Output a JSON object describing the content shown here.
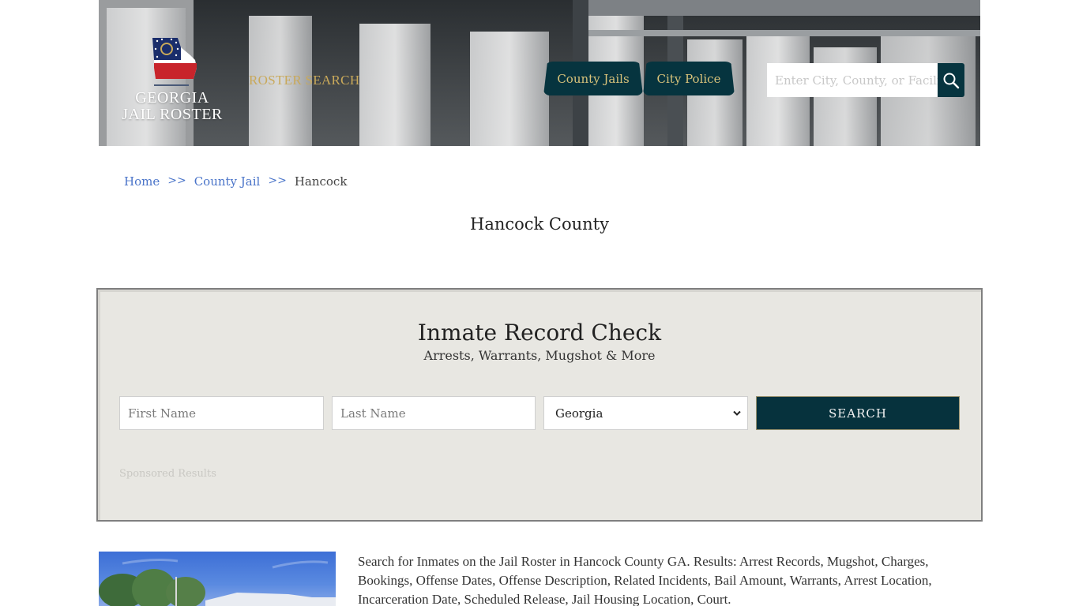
{
  "header": {
    "logo_line1": "GEORGIA",
    "logo_line2": "JAIL ROSTER",
    "roster_search_link": "ROSTER SEARCH",
    "nav": [
      {
        "label": "County Jails"
      },
      {
        "label": "City Police"
      }
    ],
    "search": {
      "placeholder": "Enter City, County, or Facility",
      "value": ""
    },
    "colors": {
      "nav_bg": "#06343f",
      "nav_text": "#d7c27a",
      "roster_link": "#c9a95a"
    }
  },
  "breadcrumb": {
    "items": [
      {
        "label": "Home"
      },
      {
        "label": "County Jail"
      },
      {
        "label": "Hancock"
      }
    ],
    "separator": ">>"
  },
  "page": {
    "title": "Hancock County"
  },
  "record_check": {
    "title": "Inmate Record Check",
    "subtitle": "Arrests, Warrants, Mugshot & More",
    "first_name": {
      "placeholder": "First Name",
      "value": ""
    },
    "last_name": {
      "placeholder": "Last Name",
      "value": ""
    },
    "state_select": {
      "selected": "Georgia"
    },
    "submit_label": "SEARCH",
    "sponsored_label": "Sponsored Results"
  },
  "content": {
    "description": "Search for Inmates on the Jail Roster in Hancock County GA. Results: Arrest Records, Mugshot, Charges, Bookings, Offense Dates, Offense Description, Related Incidents, Bail Amount, Warrants, Arrest Location, Incarceration Date, Scheduled Release, Jail Housing Location, Court."
  }
}
